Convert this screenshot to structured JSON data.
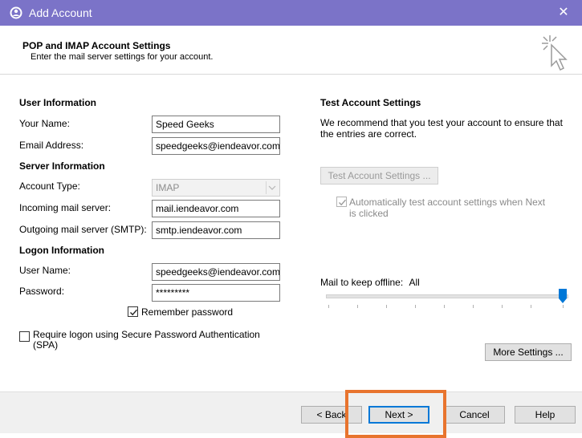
{
  "window": {
    "title": "Add Account",
    "close_glyph": "✕",
    "app_icon": "outlook-icon"
  },
  "header": {
    "title": "POP and IMAP Account Settings",
    "subtitle": "Enter the mail server settings for your account.",
    "icon": "cursor-click-icon"
  },
  "user_information": {
    "heading": "User Information",
    "your_name_label": "Your Name:",
    "your_name_value": "Speed Geeks",
    "email_label": "Email Address:",
    "email_value": "speedgeeks@iendeavor.com"
  },
  "server_information": {
    "heading": "Server Information",
    "account_type_label": "Account Type:",
    "account_type_value": "IMAP",
    "incoming_label": "Incoming mail server:",
    "incoming_value": "mail.iendeavor.com",
    "outgoing_label": "Outgoing mail server (SMTP):",
    "outgoing_value": "smtp.iendeavor.com"
  },
  "logon_information": {
    "heading": "Logon Information",
    "user_name_label": "User Name:",
    "user_name_value": "speedgeeks@iendeavor.com",
    "password_label": "Password:",
    "password_value": "*********",
    "remember_label": "Remember password",
    "remember_checked": true,
    "spa_label_line1": "Require logon using Secure Password Authentication",
    "spa_label_line2": "(SPA)",
    "spa_checked": false
  },
  "test_settings": {
    "heading": "Test Account Settings",
    "description_line1": "We recommend that you test your account to ensure that",
    "description_line2": "the entries are correct.",
    "test_button": "Test Account Settings ...",
    "auto_test_line1": "Automatically test account settings when Next",
    "auto_test_line2": "is clicked",
    "auto_test_checked": true
  },
  "offline": {
    "label": "Mail to keep offline:",
    "value": "All",
    "slider_level": 1.0
  },
  "more_settings_button": "More Settings ...",
  "footer": {
    "back": "< Back",
    "next": "Next >",
    "cancel": "Cancel",
    "help": "Help"
  },
  "colors": {
    "titlebar": "#7b73c8",
    "accent": "#0078d7",
    "highlight": "#e8742e"
  }
}
